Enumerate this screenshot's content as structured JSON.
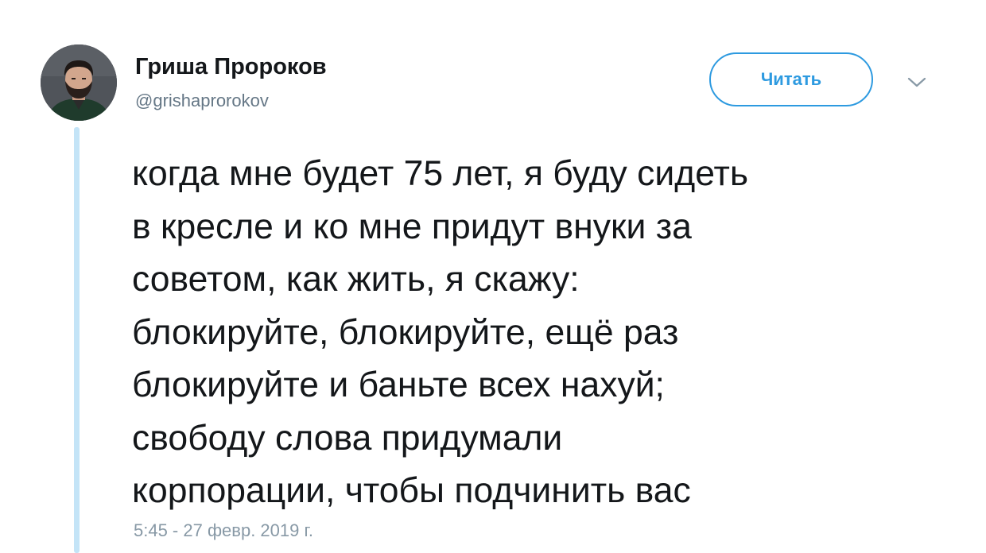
{
  "author": {
    "display_name": "Гриша Пророков",
    "handle": "@grishaprorokov"
  },
  "follow_button": {
    "label": "Читать"
  },
  "tweet": {
    "lines": [
      "когда мне будет 75 лет, я буду сидеть",
      "в кресле и ко мне придут внуки за",
      "советом, как жить, я скажу:",
      "блокируйте, блокируйте, ещё раз",
      "блокируйте и баньте всех нахуй;",
      "свободу слова придумали",
      "корпорации, чтобы подчинить вас"
    ],
    "timestamp": "5:45 - 27 февр. 2019 г."
  },
  "icons": {
    "menu": "chevron-down-icon",
    "avatar": "user-avatar"
  },
  "colors": {
    "accent": "#2d9ae0",
    "thread_line": "#c4e4f7",
    "text": "#14171a",
    "secondary_text": "#657786",
    "timestamp": "#8899a6"
  }
}
